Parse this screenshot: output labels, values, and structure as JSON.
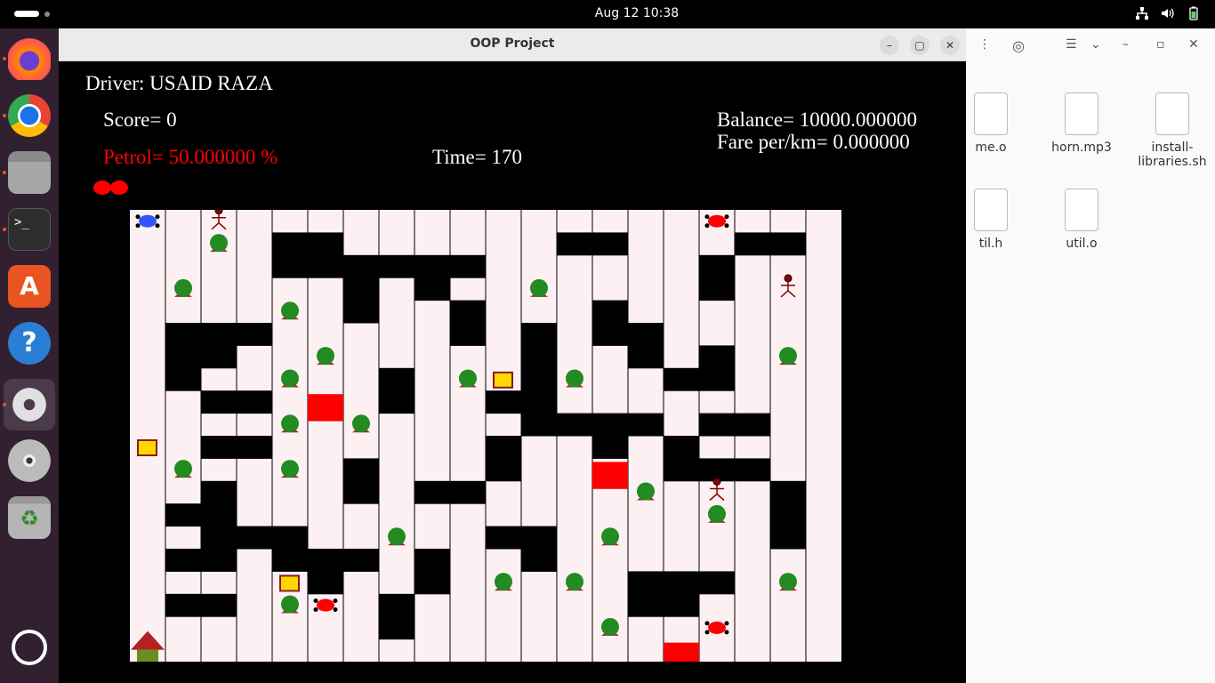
{
  "topbar": {
    "clock": "Aug 12  10:38"
  },
  "dock": {
    "items": [
      "firefox-icon",
      "chrome-icon",
      "files-icon",
      "terminal-icon",
      "app-center-icon",
      "help-icon",
      "settings-icon",
      "disc-icon",
      "trash-icon",
      "app-grid-icon"
    ]
  },
  "file_manager": {
    "files": [
      {
        "name": "me.o",
        "icon": "binary-file-icon"
      },
      {
        "name": "horn.mp3",
        "icon": "audio-file-icon"
      },
      {
        "name": "install-\nlibraries.sh",
        "icon": "script-file-icon"
      },
      {
        "name": "til.h",
        "icon": "header-file-icon"
      },
      {
        "name": "util.o",
        "icon": "binary-file-icon"
      }
    ]
  },
  "window": {
    "title": "OOP Project"
  },
  "hud": {
    "driver": "Driver: USAID RAZA",
    "score": "Score= 0",
    "balance": "Balance= 10000.000000",
    "fare": "Fare per/km= 0.000000",
    "petrol": "Petrol= 50.000000 %",
    "time": "Time= 170",
    "colors": {
      "text": "#ffffff",
      "petrol": "#ff0000",
      "board": "#fdf0f3",
      "wall": "#000000",
      "tree": "#228b22"
    }
  },
  "game": {
    "grid_columns": 20,
    "grid_rows": 20,
    "walls": [
      [
        4,
        1
      ],
      [
        4,
        2
      ],
      [
        5,
        1
      ],
      [
        5,
        2
      ],
      [
        6,
        2
      ],
      [
        6,
        3
      ],
      [
        6,
        4
      ],
      [
        7,
        2
      ],
      [
        8,
        2
      ],
      [
        8,
        3
      ],
      [
        9,
        2
      ],
      [
        9,
        4
      ],
      [
        9,
        5
      ],
      [
        12,
        1
      ],
      [
        13,
        1
      ],
      [
        13,
        4
      ],
      [
        13,
        5
      ],
      [
        16,
        2
      ],
      [
        16,
        3
      ],
      [
        17,
        1
      ],
      [
        18,
        1
      ],
      [
        1,
        5
      ],
      [
        1,
        6
      ],
      [
        1,
        7
      ],
      [
        2,
        5
      ],
      [
        2,
        6
      ],
      [
        3,
        5
      ],
      [
        2,
        8
      ],
      [
        3,
        8
      ],
      [
        2,
        10
      ],
      [
        3,
        10
      ],
      [
        7,
        7
      ],
      [
        7,
        8
      ],
      [
        10,
        8
      ],
      [
        11,
        5
      ],
      [
        11,
        6
      ],
      [
        11,
        7
      ],
      [
        11,
        8
      ],
      [
        11,
        9
      ],
      [
        12,
        9
      ],
      [
        13,
        9
      ],
      [
        13,
        10
      ],
      [
        14,
        5
      ],
      [
        14,
        6
      ],
      [
        14,
        9
      ],
      [
        15,
        7
      ],
      [
        15,
        10
      ],
      [
        15,
        11
      ],
      [
        16,
        6
      ],
      [
        16,
        7
      ],
      [
        16,
        9
      ],
      [
        16,
        11
      ],
      [
        17,
        9
      ],
      [
        17,
        11
      ],
      [
        10,
        10
      ],
      [
        10,
        11
      ],
      [
        6,
        11
      ],
      [
        6,
        12
      ],
      [
        8,
        12
      ],
      [
        9,
        12
      ],
      [
        2,
        12
      ],
      [
        2,
        13
      ],
      [
        2,
        14
      ],
      [
        2,
        15
      ],
      [
        1,
        13
      ],
      [
        1,
        15
      ],
      [
        3,
        14
      ],
      [
        4,
        14
      ],
      [
        4,
        15
      ],
      [
        5,
        15
      ],
      [
        5,
        16
      ],
      [
        6,
        15
      ],
      [
        10,
        14
      ],
      [
        11,
        14
      ],
      [
        11,
        15
      ],
      [
        8,
        15
      ],
      [
        8,
        16
      ],
      [
        7,
        17
      ],
      [
        7,
        18
      ],
      [
        14,
        16
      ],
      [
        14,
        17
      ],
      [
        15,
        16
      ],
      [
        15,
        17
      ],
      [
        16,
        16
      ],
      [
        1,
        17
      ],
      [
        2,
        17
      ],
      [
        18,
        12
      ],
      [
        18,
        13
      ],
      [
        18,
        14
      ]
    ],
    "red_blocks": [
      [
        5,
        8
      ],
      [
        13,
        11
      ],
      [
        15,
        19
      ]
    ],
    "yellow_boxes": [
      [
        0,
        10
      ],
      [
        10,
        7
      ],
      [
        4,
        16
      ]
    ],
    "trees": [
      [
        1,
        3
      ],
      [
        2,
        1
      ],
      [
        4,
        4
      ],
      [
        5,
        6
      ],
      [
        4,
        7
      ],
      [
        4,
        9
      ],
      [
        6,
        9
      ],
      [
        4,
        11
      ],
      [
        1,
        11
      ],
      [
        9,
        7
      ],
      [
        12,
        7
      ],
      [
        11,
        3
      ],
      [
        18,
        6
      ],
      [
        14,
        12
      ],
      [
        16,
        13
      ],
      [
        7,
        14
      ],
      [
        13,
        14
      ],
      [
        10,
        16
      ],
      [
        12,
        16
      ],
      [
        18,
        16
      ],
      [
        4,
        17
      ],
      [
        13,
        18
      ]
    ],
    "passengers": [
      [
        2,
        0
      ],
      [
        18,
        3
      ],
      [
        16,
        12
      ]
    ],
    "npc_cars": [
      [
        16,
        0
      ],
      [
        5,
        17
      ],
      [
        16,
        18
      ]
    ],
    "player_car": [
      0,
      0
    ],
    "fuel_station": [
      0,
      19
    ],
    "lives": 2
  }
}
